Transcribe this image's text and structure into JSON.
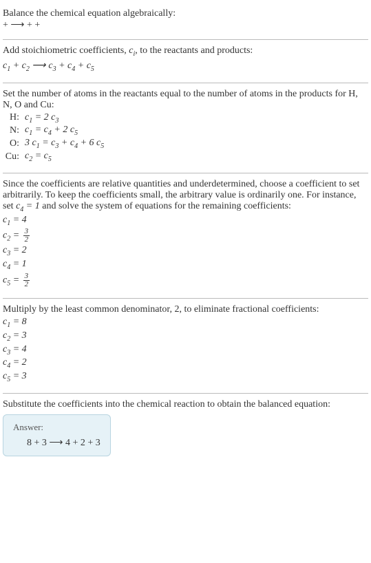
{
  "section1": {
    "line1": "Balance the chemical equation algebraically:",
    "line2": " +  ⟶  +  + "
  },
  "section2": {
    "line1_pre": "Add stoichiometric coefficients, ",
    "line1_ci": "c",
    "line1_ci_sub": "i",
    "line1_post": ", to the reactants and products:",
    "eq_c1": "c",
    "eq_arrow": " ⟶ "
  },
  "section3": {
    "line1": "Set the number of atoms in the reactants equal to the number of atoms in the products for H, N, O and Cu:",
    "atoms": [
      {
        "label": "H:",
        "lhs": "c₁",
        "rhs": "2 c₃"
      },
      {
        "label": "N:",
        "lhs": "c₁",
        "rhs": "c₄ + 2 c₅"
      },
      {
        "label": "O:",
        "lhs": "3 c₁",
        "rhs": "c₃ + c₄ + 6 c₅"
      },
      {
        "label": "Cu:",
        "lhs": "c₂",
        "rhs": "c₅"
      }
    ]
  },
  "section4": {
    "line1_a": "Since the coefficients are relative quantities and underdetermined, choose a coefficient to set arbitrarily. To keep the coefficients small, the arbitrary value is ordinarily one. For instance, set ",
    "line1_b": "c₄ = 1",
    "line1_c": " and solve the system of equations for the remaining coefficients:",
    "c1": "c₁ = 4",
    "c2_lhs": "c₂ = ",
    "c2_num": "3",
    "c2_den": "2",
    "c3": "c₃ = 2",
    "c4": "c₄ = 1",
    "c5_lhs": "c₅ = ",
    "c5_num": "3",
    "c5_den": "2"
  },
  "section5": {
    "line1": "Multiply by the least common denominator, 2, to eliminate fractional coefficients:",
    "c1": "c₁ = 8",
    "c2": "c₂ = 3",
    "c3": "c₃ = 4",
    "c4": "c₄ = 2",
    "c5": "c₅ = 3"
  },
  "section6": {
    "line1": "Substitute the coefficients into the chemical reaction to obtain the balanced equation:"
  },
  "answer": {
    "label": "Answer:",
    "eq": "8  + 3  ⟶ 4  + 2  + 3 "
  }
}
